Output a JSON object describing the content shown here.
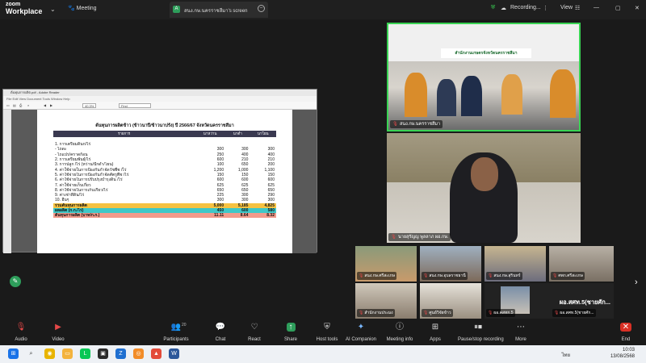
{
  "app": {
    "logo_line1": "zoom",
    "logo_line2": "Workplace",
    "meeting_tab": "Meeting",
    "share_tab": "สนง.กษ.นครราชสีมา's screen",
    "recording_label": "Recording...",
    "view_label": "View"
  },
  "document": {
    "window_title": "ต้นทุนการผลิต.pdf - Adobe Reader",
    "menu_text": "File  Edit  View  Document  Tools  Window  Help",
    "zoom_value": "40.3%",
    "find_placeholder": "Find",
    "table": {
      "title": "ต้นทุนการผลิตข้าว (ข้าวนาปี/ข้าวนาปรัง) ปี 2566/67 จังหวัดนครราชสีมา",
      "headers": [
        "รายการ",
        "นาหว่าน",
        "นาดำ",
        "นาโยน"
      ],
      "rows": [
        [
          "1. การเตรียมดินก/ไร่",
          "",
          "",
          ""
        ],
        [
          "- ไถดะ",
          "300",
          "300",
          "300"
        ],
        [
          "- ไถแปร/คราดก้อน",
          "250",
          "400",
          "400"
        ],
        [
          "2. การเตรียมพันธุ์/ไร่",
          "600",
          "210",
          "210"
        ],
        [
          "3. การปลูก /ไร่ (หว่าน/ปักดำ/โยน)",
          "100",
          "650",
          "200"
        ],
        [
          "4. ค่าใช้จ่ายในการป้องกันกำจัดวัชพืช /ไร่",
          "1,200",
          "1,000",
          "1,100"
        ],
        [
          "5. ค่าใช้จ่ายในการป้องกันกำจัดศัตรูพืช /ไร่",
          "150",
          "150",
          "150"
        ],
        [
          "6. ค่าใช้จ่ายในการปรับปรุงบำรุงดิน /ไร่",
          "600",
          "600",
          "600"
        ],
        [
          "7. ค่าใช้จ่ายเก็บเกี่ยว",
          "625",
          "625",
          "625"
        ],
        [
          "8. ค่าใช้จ่ายในการเก็บเกี่ยว/ไร่",
          "650",
          "650",
          "650"
        ],
        [
          "9. ค่าเช่าที่ดิน/ไร่",
          "225",
          "300",
          "290"
        ],
        [
          "10. อื่นๆ",
          "300",
          "300",
          "300"
        ]
      ],
      "total": [
        "รวมต้นทุนการผลิต",
        "5,000",
        "5,185",
        "4,825"
      ],
      "yield": [
        "ผลผลิต (ก.ก./ไร่)",
        "450",
        "600",
        "580"
      ],
      "per_unit": [
        "ต้นทุนการผลิต (บาท/ก.ก.)",
        "11.11",
        "8.64",
        "8.32"
      ]
    }
  },
  "tiles": {
    "room_banner": "สำนักงานเกษตรจังหวัดนครราชสีมา",
    "room_name": "สนง.กษ.นครราชสีมา",
    "speaker_name": "นายสุรัญญ พูลลาภ ผอ.กษ."
  },
  "gallery": [
    {
      "name": "สนง.กษ.ศรีสะเกษ"
    },
    {
      "name": "สนง.กษ.อุบลราชธานี"
    },
    {
      "name": "สนง.กษ.สุรินทร์"
    },
    {
      "name": "ศพก.ศรีสะเกษ"
    },
    {
      "name": "สำนักงานประมง"
    },
    {
      "name": "ศูนย์วิจัยข้าว"
    },
    {
      "name": "ผอ.คสทก.5",
      "big": "ผอ.สศท.5(ชายศัก..."
    },
    {
      "name": "ผอ.สศท.5(ชายศัก..."
    }
  ],
  "toolbar": {
    "audio": "Audio",
    "video": "Video",
    "participants": "Participants",
    "participants_count": "20",
    "chat": "Chat",
    "react": "React",
    "share": "Share",
    "host_tools": "Host tools",
    "ai_companion": "AI Companion",
    "meeting_info": "Meeting info",
    "apps": "Apps",
    "pause_stop": "Pause/stop recording",
    "more": "More",
    "end": "End"
  },
  "taskbar": {
    "lang": "ไทย",
    "time": "10:03",
    "date": "13/08/2568"
  },
  "colors": {
    "active_speaker_border": "#39d353",
    "total_row": "#f6c242",
    "yield_row": "#3fc8c8",
    "per_unit_row": "#f39a8b",
    "end_button": "#d93025",
    "share_button": "#2e9e5b"
  }
}
